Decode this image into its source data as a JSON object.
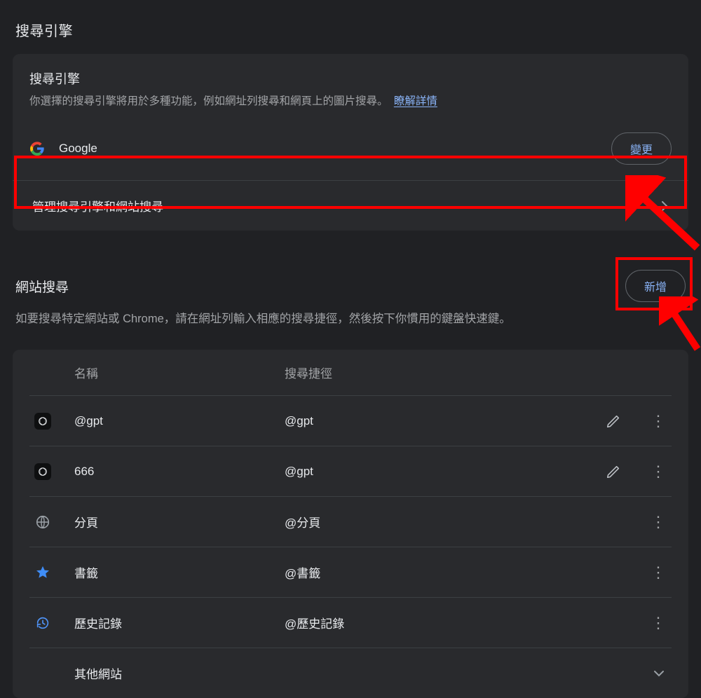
{
  "page_title": "搜尋引擎",
  "card": {
    "title": "搜尋引擎",
    "desc": "你選擇的搜尋引擎將用於多種功能，例如網址列搜尋和網頁上的圖片搜尋。",
    "learn_more": "瞭解詳情",
    "current_name": "Google",
    "change_btn": "變更",
    "manage_label": "管理搜尋引擎和網站搜尋"
  },
  "section": {
    "title": "網站搜尋",
    "add_btn": "新增",
    "desc": "如要搜尋特定網站或 Chrome，請在網址列輸入相應的搜尋捷徑，然後按下你慣用的鍵盤快速鍵。"
  },
  "columns": {
    "name": "名稱",
    "shortcut": "搜尋捷徑"
  },
  "rows": [
    {
      "icon": "openai",
      "name": "@gpt",
      "shortcut": "@gpt",
      "editable": true
    },
    {
      "icon": "openai",
      "name": "666",
      "shortcut": "@gpt",
      "editable": true
    },
    {
      "icon": "globe",
      "name": "分頁",
      "shortcut": "@分頁",
      "editable": false
    },
    {
      "icon": "star",
      "name": "書籤",
      "shortcut": "@書籤",
      "editable": false
    },
    {
      "icon": "history",
      "name": "歷史記錄",
      "shortcut": "@歷史記錄",
      "editable": false
    }
  ],
  "other": {
    "label": "其他網站"
  }
}
